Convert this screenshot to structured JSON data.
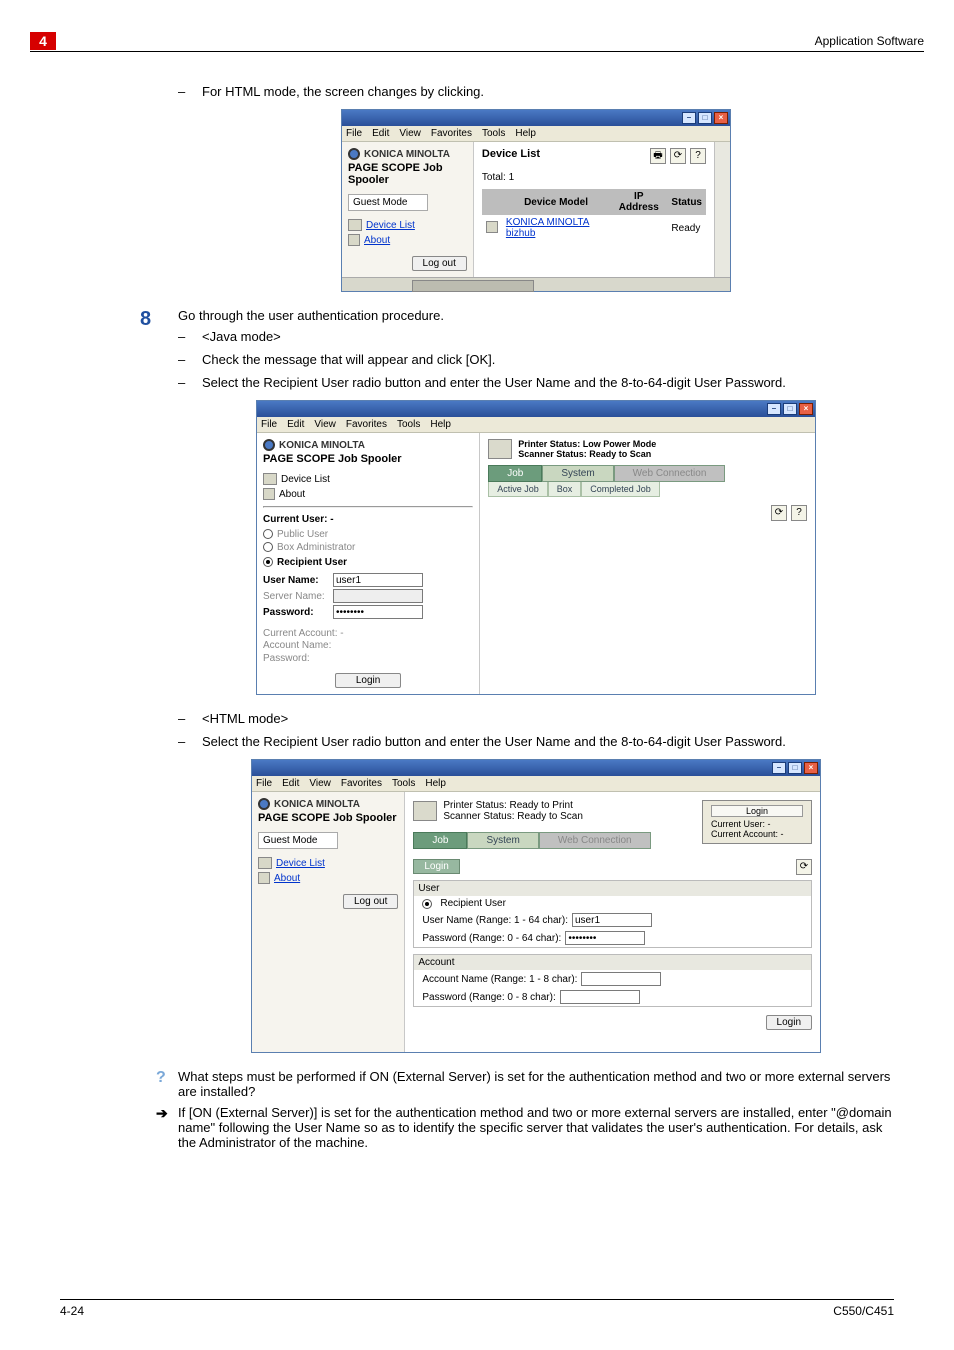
{
  "header": {
    "chapter": "4",
    "title_right": "Application Software"
  },
  "line_top": "For HTML mode, the screen changes by clicking.",
  "shot1": {
    "menus": [
      "File",
      "Edit",
      "View",
      "Favorites",
      "Tools",
      "Help"
    ],
    "brand": "KONICA MINOLTA",
    "spooler": "PAGE SCOPE Job Spooler",
    "guest_mode": "Guest Mode",
    "nav": {
      "device_list": "Device List",
      "about": "About"
    },
    "logout": "Log out",
    "panel_title": "Device List",
    "total": "Total: 1",
    "cols": {
      "model": "Device Model",
      "ip": "IP Address",
      "status": "Status"
    },
    "row": {
      "model": "KONICA MINOLTA bizhub",
      "status": "Ready"
    }
  },
  "step8": {
    "num": "8",
    "text": "Go through the user authentication procedure.",
    "l1": "<Java mode>",
    "l2": "Check the message that will appear and click [OK].",
    "l3": "Select the Recipient User radio button and enter the User Name and the 8-to-64-digit User Password."
  },
  "shot2": {
    "menus": [
      "File",
      "Edit",
      "View",
      "Favorites",
      "Tools",
      "Help"
    ],
    "brand": "KONICA MINOLTA",
    "spooler": "PAGE SCOPE Job Spooler",
    "nav": {
      "device_list": "Device List",
      "about": "About"
    },
    "current_user_label": "Current User: -",
    "opt_public": "Public User",
    "opt_boxadmin": "Box Administrator",
    "opt_recipient": "Recipient User",
    "username_label": "User Name:",
    "username_value": "user1",
    "server_label": "Server Name:",
    "password_label": "Password:",
    "password_value": "********",
    "acct_label": "Current Account: -",
    "acctname_label": "Account Name:",
    "acctpw_label": "Password:",
    "login": "Login",
    "printer_status_l": "Printer Status:",
    "printer_status_v": "Low Power Mode",
    "scanner_status_l": "Scanner Status:",
    "scanner_status_v": "Ready to Scan",
    "tabs": {
      "job": "Job",
      "system": "System",
      "web": "Web Connection"
    },
    "subtabs": {
      "active": "Active Job",
      "box": "Box",
      "completed": "Completed Job"
    }
  },
  "html_mode": {
    "l1": "<HTML mode>",
    "l2": "Select the Recipient User radio button and enter the User Name and the 8-to-64-digit User Password."
  },
  "shot3": {
    "menus": [
      "File",
      "Edit",
      "View",
      "Favorites",
      "Tools",
      "Help"
    ],
    "brand": "KONICA MINOLTA",
    "spooler": "PAGE SCOPE Job Spooler",
    "guest_mode": "Guest Mode",
    "nav": {
      "device_list": "Device List",
      "about": "About"
    },
    "logout": "Log out",
    "printer_status": "Printer Status: Ready to Print",
    "scanner_status": "Scanner Status: Ready to Scan",
    "badge": {
      "login": "Login",
      "cu": "Current User: -",
      "ca": "Current Account: -"
    },
    "tabs": {
      "job": "Job",
      "system": "System",
      "web": "Web Connection"
    },
    "login_label": "Login",
    "user_header": "User",
    "recipient": "Recipient User",
    "un_label": "User Name (Range: 1 - 64 char):",
    "un_value": "user1",
    "pw_label": "Password (Range: 0 - 64 char):",
    "pw_value": "********",
    "acct_header": "Account",
    "acct_name": "Account Name (Range: 1 - 8 char):",
    "acct_pw": "Password (Range: 0 - 8 char):",
    "login_btn": "Login"
  },
  "qa": {
    "q": "What steps must be performed if ON (External Server) is set for the authentication method and two or more external servers are installed?",
    "a": "If [ON (External Server)] is set for the authentication method and two or more external servers are installed, enter \"@domain name\" following the User Name so as to identify the specific server that validates the user's authentication. For details, ask the Administrator of the machine."
  },
  "footer": {
    "left": "4-24",
    "right": "C550/C451"
  }
}
